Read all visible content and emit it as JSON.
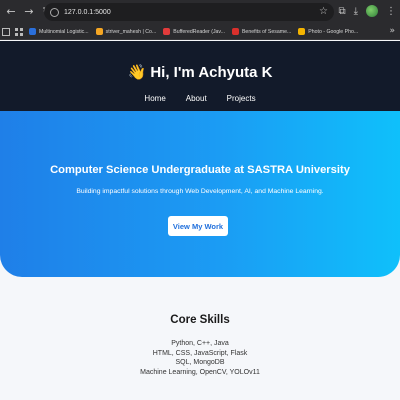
{
  "browser": {
    "url": "127.0.0.1:5000",
    "bookmarks": [
      {
        "label": "Multinomial Logistic...",
        "color": "#2a6fdb"
      },
      {
        "label": "striver_mahesh | Co...",
        "color": "#f5a623"
      },
      {
        "label": "BufferedReader (Jav...",
        "color": "#e23b3b"
      },
      {
        "label": "Benefits of Sesame...",
        "color": "#d9302c"
      },
      {
        "label": "Photo - Google Pho...",
        "color": "#f4b400"
      }
    ]
  },
  "header": {
    "title": "👋 Hi, I'm Achyuta K",
    "nav": [
      "Home",
      "About",
      "Projects"
    ]
  },
  "hero": {
    "subtitle": "Computer Science Undergraduate at SASTRA University",
    "description": "Building impactful solutions through Web Development, AI, and Machine Learning.",
    "cta": "View My Work"
  },
  "skills": {
    "title": "Core Skills",
    "items": [
      "Python, C++, Java",
      "HTML, CSS, JavaScript, Flask",
      "SQL, MongoDB",
      "Machine Learning, OpenCV, YOLOv11"
    ]
  }
}
